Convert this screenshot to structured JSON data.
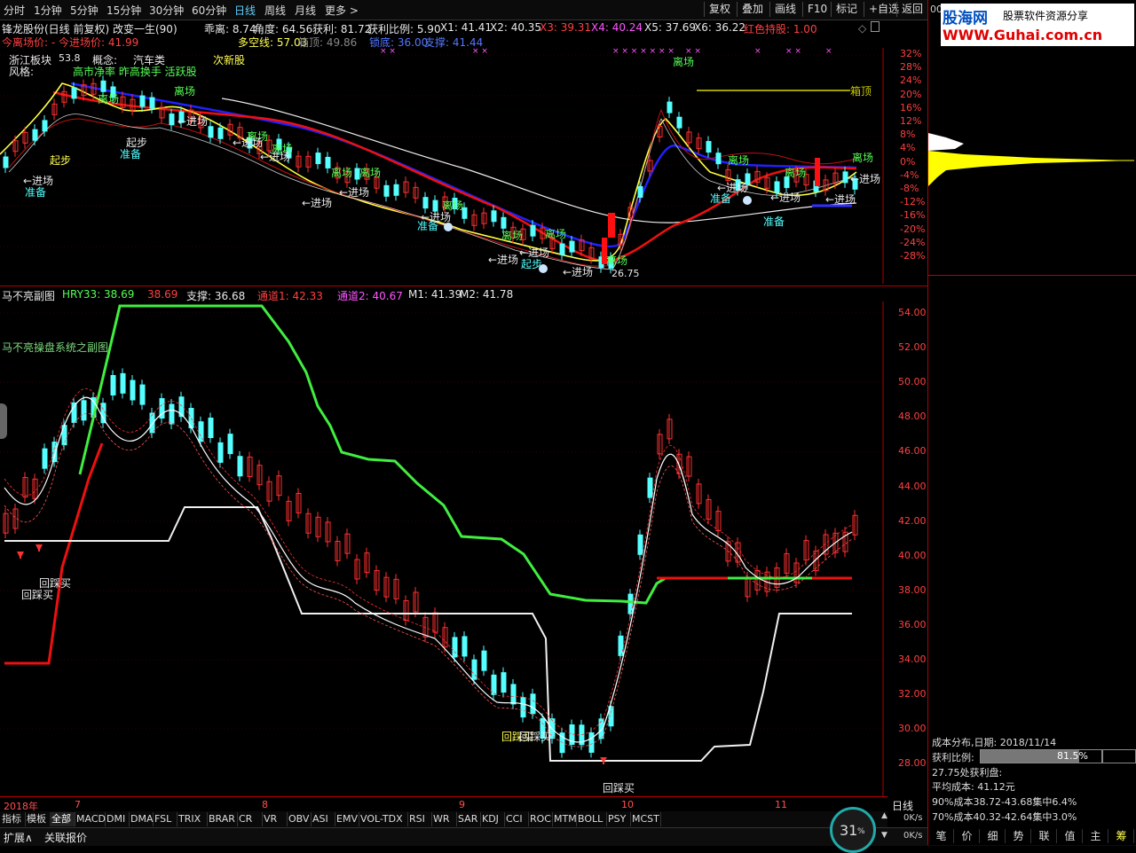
{
  "toolbar": {
    "periods": [
      "分时",
      "1分钟",
      "5分钟",
      "15分钟",
      "30分钟",
      "60分钟",
      "日线",
      "周线",
      "月线",
      "更多 >"
    ],
    "active_period": "日线",
    "buttons": [
      "复权",
      "叠加",
      "画线",
      "F10",
      "标记",
      "+自选",
      "返回"
    ]
  },
  "header": {
    "stock_title": "锋龙股份(日线 前复权) 改变一生(90)",
    "today_exit_price": "今离场价: - 今进场价: 41.99",
    "indicators": [
      {
        "text": "乖离: 8.74",
        "color": "#e8e8e8"
      },
      {
        "text": "角度: 64.56",
        "color": "#e8e8e8"
      },
      {
        "text": "获利: 81.72",
        "color": "#e8e8e8"
      },
      {
        "text": "获利比例: 5.90",
        "color": "#e8e8e8"
      },
      {
        "text": "X1: 41.41",
        "color": "#e8e8e8"
      },
      {
        "text": "X2: 40.35",
        "color": "#e8e8e8"
      },
      {
        "text": "X3: 39.31",
        "color": "#ff4040"
      },
      {
        "text": "X4: 40.24",
        "color": "#ff55ff"
      },
      {
        "text": "X5: 37.69",
        "color": "#e8e8e8"
      },
      {
        "text": "X6: 36.22",
        "color": "#e8e8e8"
      },
      {
        "text": "红色持股: 1.00",
        "color": "#ff4040"
      }
    ],
    "line2": [
      {
        "text": "多空线: 57.03",
        "color": "#ffff55"
      },
      {
        "text": "箱顶: 49.86",
        "color": "#888888"
      },
      {
        "text": "锁底: 36.00",
        "color": "#5577ff"
      },
      {
        "text": "支撑: 41.44",
        "color": "#5577ff"
      }
    ],
    "concept_labels": {
      "region": "浙江板块",
      "concept": "概念:",
      "concept_val": "汽车类",
      "next": "次新股",
      "style": "风格:",
      "style_val": "高市净率 昨高换手 活跃股",
      "price_tag": "53.8"
    },
    "icons": [
      "diamond-icon",
      "square-icon",
      "square-icon"
    ]
  },
  "upper_axis": [
    "32%",
    "28%",
    "24%",
    "20%",
    "16%",
    "12%",
    "8%",
    "4%",
    "0%",
    "-4%",
    "-8%",
    "-12%",
    "-16%",
    "-20%",
    "-24%",
    "-28%"
  ],
  "upper_signals": {
    "qibu": "起步",
    "zhunbei": "准备",
    "jinchang": "←进场",
    "lichang": "离场",
    "jianxiang": "箱顶",
    "lowprice": "26.75"
  },
  "lower_header": [
    {
      "text": "马不亮副图",
      "color": "#e8e8e8"
    },
    {
      "text": "HRY33: 38.69",
      "color": "#55ff55"
    },
    {
      "text": "38.69",
      "color": "#ff4040"
    },
    {
      "text": "支撑: 36.68",
      "color": "#e8e8e8"
    },
    {
      "text": "通道1: 42.33",
      "color": "#ff4040"
    },
    {
      "text": "通道2: 40.67",
      "color": "#ff55ff"
    },
    {
      "text": "M1: 41.39",
      "color": "#e8e8e8"
    },
    {
      "text": "M2: 41.78",
      "color": "#e8e8e8"
    }
  ],
  "lower_subtitle": "马不亮操盘系统之副图",
  "lower_axis": [
    "54.00",
    "52.00",
    "50.00",
    "48.00",
    "46.00",
    "44.00",
    "42.00",
    "40.00",
    "38.00",
    "36.00",
    "34.00",
    "32.00",
    "30.00",
    "28.00"
  ],
  "lower_signals": {
    "huicai_mai": "回踩买"
  },
  "date_axis": [
    "2018年",
    "7",
    "8",
    "9",
    "10",
    "11"
  ],
  "date_right": "日线",
  "tabs": [
    "指标",
    "模板",
    "全部",
    "MACD",
    "DMI",
    "DMA",
    "FSL",
    "TRIX",
    "BRAR",
    "CR",
    "VR",
    "OBV",
    "ASI",
    "EMV",
    "VOL-TDX",
    "RSI",
    "WR",
    "SAR",
    "KDJ",
    "CCI",
    "ROC",
    "MTM",
    "BOLL",
    "PSY",
    "MCST"
  ],
  "active_tab": "全部",
  "status": {
    "expand": "扩展∧",
    "related": "关联报价",
    "gauge": "31",
    "gauge_unit": "%",
    "speed_up": "0K/s",
    "speed_down": "0K/s"
  },
  "right_panel": {
    "logo_cn": "股海网",
    "logo_slogan": "股票软件资源分享",
    "logo_url": "WWW.Guhai.com.cn",
    "top_num": "00",
    "cost_date": "成本分布,日期: 2018/11/14",
    "profit_label": "获利比例:",
    "profit_value": "81.5%",
    "profit_ratio": 0.815,
    "line1": "27.75处获利盘:",
    "line2": "平均成本: 41.12元",
    "line3": "90%成本38.72-43.68集中6.4%",
    "line4": "70%成本40.32-42.64集中3.0%",
    "tabs": [
      "笔",
      "价",
      "细",
      "势",
      "联",
      "值",
      "主",
      "筹"
    ]
  }
}
